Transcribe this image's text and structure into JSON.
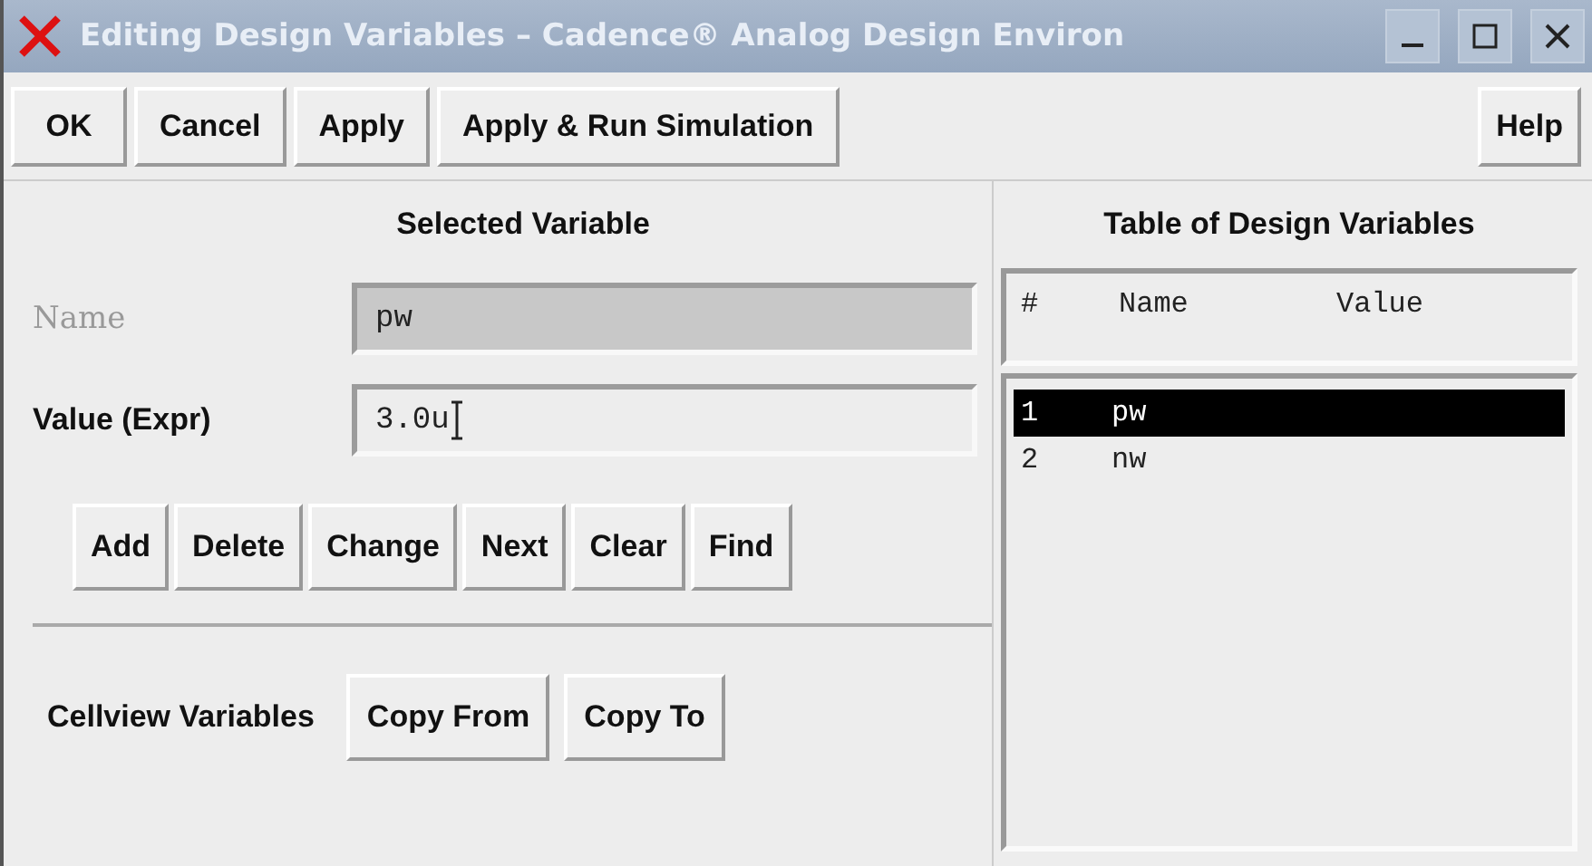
{
  "window": {
    "title": "Editing Design Variables – Cadence® Analog Design Environ"
  },
  "toolbar": {
    "buttons": [
      "OK",
      "Cancel",
      "Apply",
      "Apply & Run Simulation"
    ],
    "help": "Help"
  },
  "selected_variable": {
    "heading": "Selected Variable",
    "fields": [
      {
        "label": "Name",
        "value": "pw",
        "disabled": true
      },
      {
        "label": "Value (Expr)",
        "value": "3.0u",
        "disabled": false
      }
    ],
    "actions": [
      "Add",
      "Delete",
      "Change",
      "Next",
      "Clear",
      "Find"
    ],
    "cellview": {
      "label": "Cellview Variables",
      "buttons": [
        "Copy From",
        "Copy To"
      ]
    }
  },
  "table": {
    "heading": "Table of Design Variables",
    "columns": [
      "#",
      "Name",
      "Value"
    ],
    "rows": [
      {
        "cells": [
          "1",
          "pw"
        ],
        "selected": true
      },
      {
        "cells": [
          "2",
          "nw"
        ],
        "selected": false
      }
    ]
  }
}
